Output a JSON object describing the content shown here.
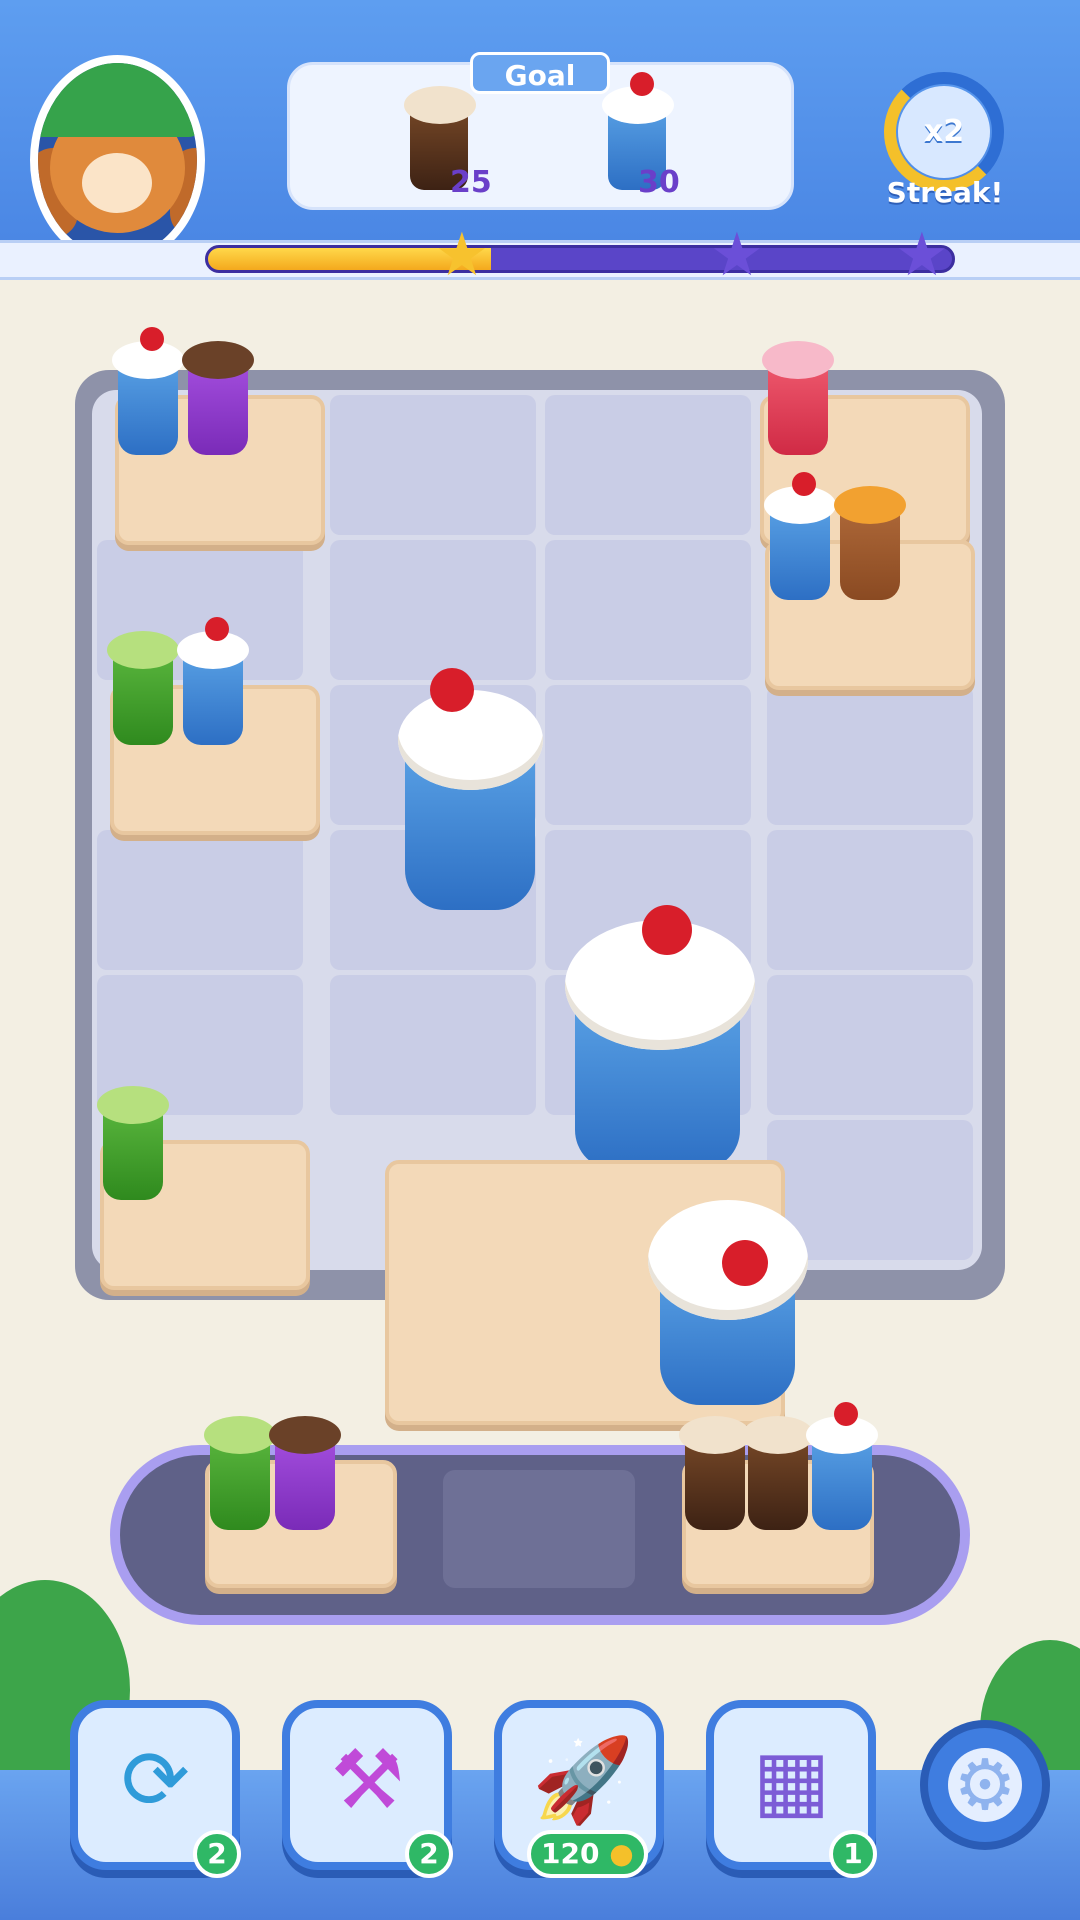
{
  "header": {
    "goal_label": "Goal",
    "goals": [
      {
        "item": "latte-cup",
        "count": "25"
      },
      {
        "item": "cherry-sundae-cup",
        "count": "30"
      }
    ],
    "streak": {
      "multiplier": "x2",
      "label": "Streak!"
    },
    "progress": {
      "fraction": 0.38,
      "stars_earned": 1,
      "stars_total": 3
    }
  },
  "tools": [
    {
      "name": "shuffle",
      "icon": "shuffle-icon",
      "count": "2"
    },
    {
      "name": "hammer",
      "icon": "hammer-icon",
      "count": "2"
    },
    {
      "name": "rocket",
      "icon": "rocket-icon",
      "count": "120"
    },
    {
      "name": "tray-swap",
      "icon": "tray-swap-icon",
      "count": "1"
    }
  ],
  "colors": {
    "latte": "#5a3720",
    "sundae": "#3a86d6",
    "matcha": "#3d9a2c",
    "grape": "#8c3ccd",
    "berry": "#e23a57",
    "tea": "#9a5b2d"
  }
}
